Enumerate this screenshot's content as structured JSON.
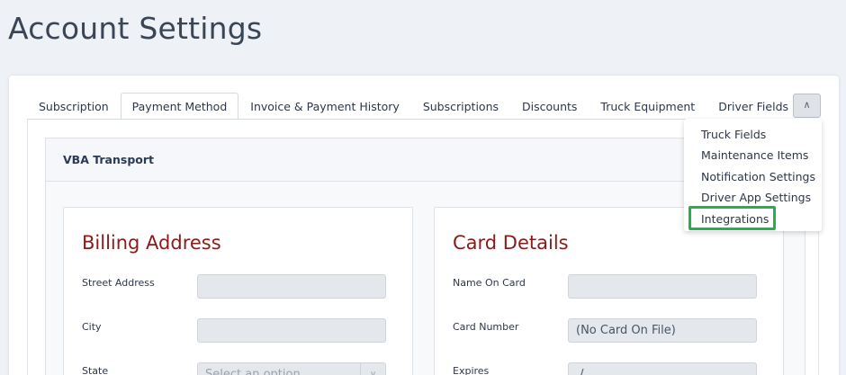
{
  "page": {
    "title": "Account Settings"
  },
  "tabs": [
    {
      "label": "Subscription"
    },
    {
      "label": "Payment Method",
      "active": true
    },
    {
      "label": "Invoice & Payment History"
    },
    {
      "label": "Subscriptions"
    },
    {
      "label": "Discounts"
    },
    {
      "label": "Truck Equipment"
    },
    {
      "label": "Driver Fields"
    }
  ],
  "more_menu": {
    "toggle_icon": "chevron-up-icon",
    "items": [
      {
        "label": "Truck Fields"
      },
      {
        "label": "Maintenance Items"
      },
      {
        "label": "Notification Settings"
      },
      {
        "label": "Driver App Settings"
      },
      {
        "label": "Integrations",
        "highlighted": true
      }
    ],
    "highlight_color": "#22b14c"
  },
  "company": {
    "name": "VBA Transport"
  },
  "billing": {
    "title": "Billing Address",
    "fields": [
      {
        "label": "Street Address",
        "value": ""
      },
      {
        "label": "City",
        "value": ""
      },
      {
        "label": "State",
        "placeholder": "Select an option"
      }
    ]
  },
  "card": {
    "title": "Card Details",
    "fields": [
      {
        "label": "Name On Card",
        "value": ""
      },
      {
        "label": "Card Number",
        "value": "(No Card On File)"
      },
      {
        "label": "Expires",
        "value": " / "
      }
    ]
  },
  "colors": {
    "section_title": "#8b1a1a",
    "background": "#eef1f6",
    "highlight": "#22b14c"
  }
}
